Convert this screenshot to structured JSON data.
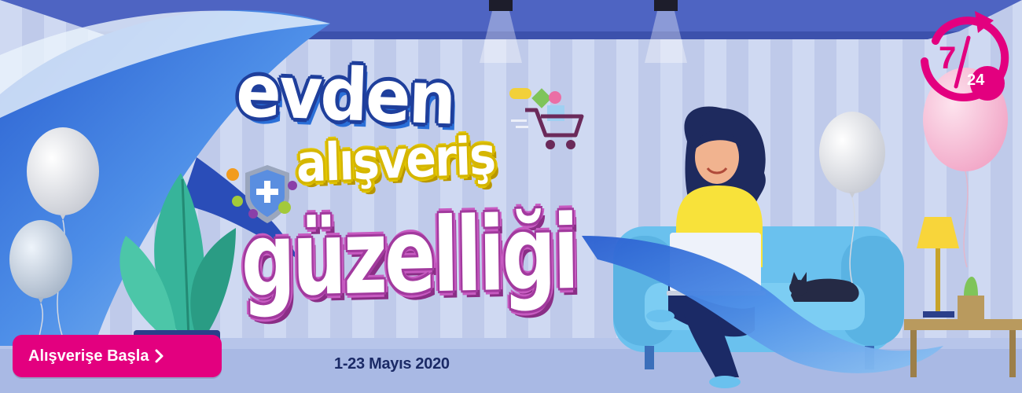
{
  "headline": {
    "line1": "evden",
    "line2": "alışveriş",
    "line3": "güzelliği"
  },
  "dates": "1-23  Mayıs 2020",
  "cta": {
    "label": "Alışverişe Başla"
  },
  "badge": {
    "left": "7",
    "right": "24"
  },
  "icons": {
    "cta_chevron": "chevron-right-icon",
    "badge": "refresh-arrow-icon",
    "cart": "shopping-cart-icon",
    "shield": "shield-plus-icon"
  },
  "colors": {
    "brand_magenta": "#e3007f",
    "wall": "#c9d3ee",
    "sofa": "#6ac1ee",
    "ribbon": "#3f7fe0",
    "shirt": "#f8e23a",
    "evden_outline": "#1f3f9c",
    "alisveris_outline": "#e3c700",
    "guzelligi_outline": "#c75bc1",
    "date_text": "#1b2a66"
  }
}
